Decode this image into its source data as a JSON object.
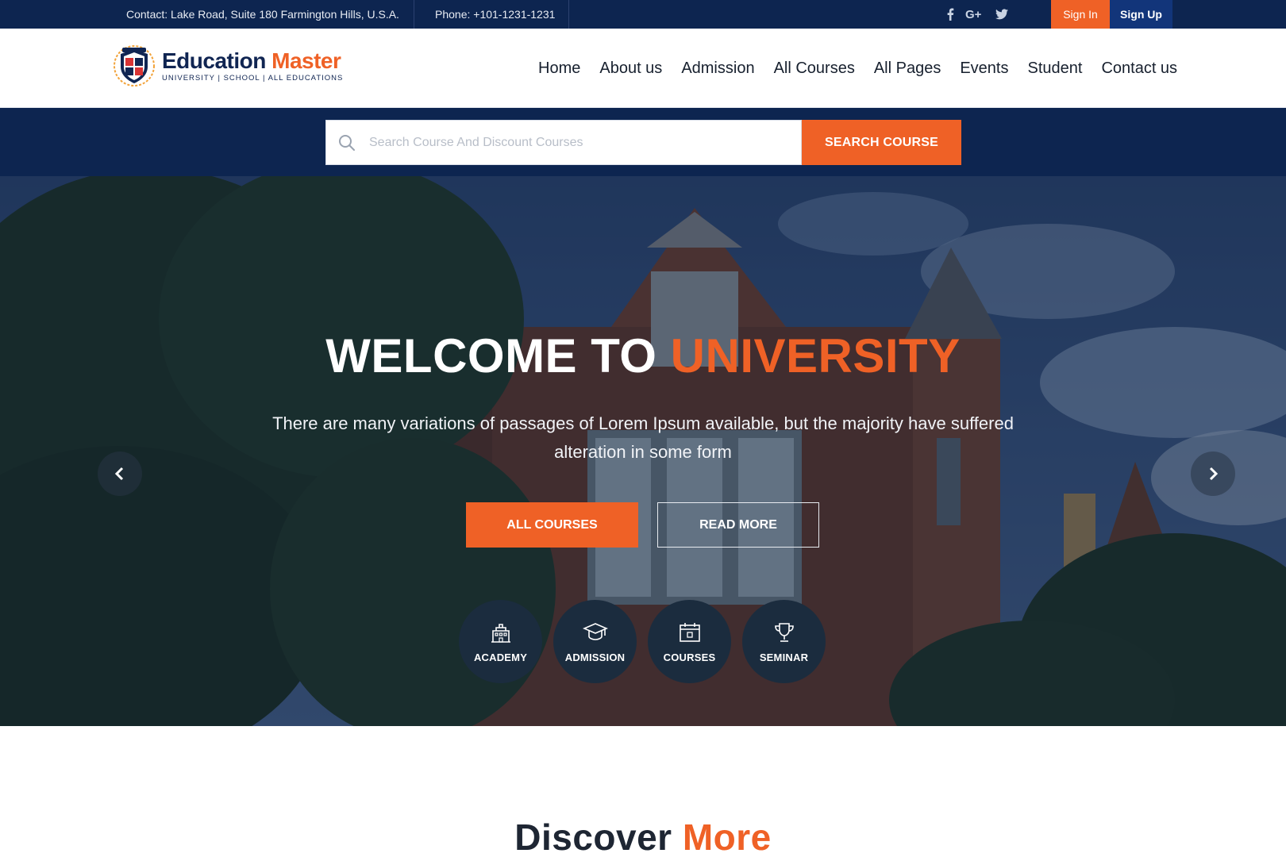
{
  "topbar": {
    "contact": "Contact: Lake Road, Suite 180 Farmington Hills, U.S.A.",
    "phone": "Phone: +101-1231-1231",
    "social": [
      "facebook-icon",
      "google-plus-icon",
      "twitter-icon"
    ],
    "sign_in": "Sign In",
    "sign_up": "Sign Up"
  },
  "header": {
    "logo_title_main": "Education",
    "logo_title_accent": "Master",
    "logo_sub": "UNIVERSITY | SCHOOL | ALL EDUCATIONS",
    "nav": [
      "Home",
      "About us",
      "Admission",
      "All Courses",
      "All Pages",
      "Events",
      "Student",
      "Contact us"
    ]
  },
  "search": {
    "placeholder": "Search Course And Discount Courses",
    "button": "SEARCH COURSE"
  },
  "hero": {
    "title_main": "WELCOME TO",
    "title_accent": "UNIVERSITY",
    "text": "There are many variations of passages of Lorem Ipsum available, but the majority have suffered alteration in some form",
    "button_primary": "ALL COURSES",
    "button_secondary": "READ MORE",
    "quick_links": [
      {
        "label": "ACADEMY",
        "icon": "building-icon"
      },
      {
        "label": "ADMISSION",
        "icon": "graduation-cap-icon"
      },
      {
        "label": "COURSES",
        "icon": "calendar-icon"
      },
      {
        "label": "SEMINAR",
        "icon": "trophy-icon"
      }
    ]
  },
  "discover": {
    "main": "Discover",
    "accent": "More"
  },
  "colors": {
    "navy": "#0d2550",
    "accent": "#ef6126",
    "signup": "#12357a"
  }
}
